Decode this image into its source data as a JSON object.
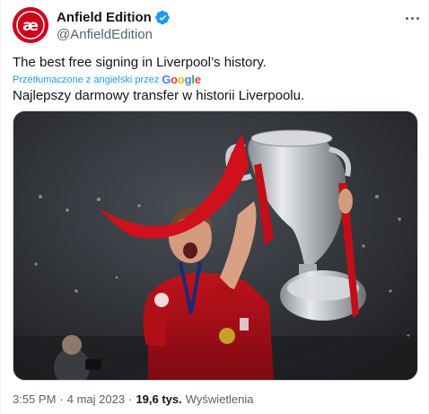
{
  "author": {
    "display_name": "Anfield Edition",
    "handle": "@AnfieldEdition",
    "avatar_glyph": "æ",
    "avatar_color": "#d0021b",
    "verified_color": "#1d9bf0"
  },
  "tweet": {
    "text_original": "The best free signing in Liverpool’s history.",
    "translated_label": "Przetłumaczone z angielski przez",
    "translator": "Google",
    "text_translated": "Najlepszy darmowy transfer w historii Liverpoolu."
  },
  "meta": {
    "time": "3:55 PM",
    "separator": "·",
    "date": "4 maj 2023",
    "views_count": "19,6 tys.",
    "views_label": "Wyświetlenia"
  },
  "colors": {
    "accent": "#1d9bf0",
    "text": "#0f1419",
    "secondary": "#536471"
  },
  "icons": [
    "verified-badge-icon",
    "more-options-icon"
  ]
}
